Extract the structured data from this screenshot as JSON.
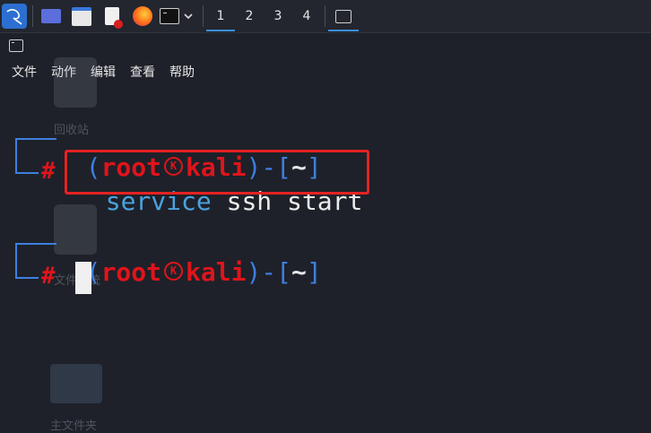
{
  "taskbar": {
    "workspaces": [
      "1",
      "2",
      "3",
      "4"
    ],
    "icons": [
      "kali-menu-icon",
      "desktop-icon",
      "file-manager-icon",
      "text-editor-icon",
      "firefox-icon",
      "terminal-icon"
    ]
  },
  "menubar": {
    "items": [
      "文件",
      "动作",
      "编辑",
      "查看",
      "帮助"
    ]
  },
  "desktop_ghosts": {
    "item1": "回收站",
    "item2": "文件系统",
    "item3": "主文件夹"
  },
  "terminal": {
    "prompt1": {
      "open": "(",
      "user": "root",
      "host": "kali",
      "close": ")-[",
      "dir": "~",
      "end": "]",
      "hash": "#"
    },
    "command": {
      "cmd": "service",
      "args": " ssh start"
    },
    "prompt2": {
      "open": "(",
      "user": "root",
      "host": "kali",
      "close": ")-[",
      "dir": "~",
      "end": "]",
      "hash": "#"
    }
  },
  "colors": {
    "background": "#1e2129",
    "prompt_blue": "#3e7fe0",
    "prompt_red": "#e0141b",
    "command_blue": "#4aa3df",
    "highlight": "#e52222"
  }
}
